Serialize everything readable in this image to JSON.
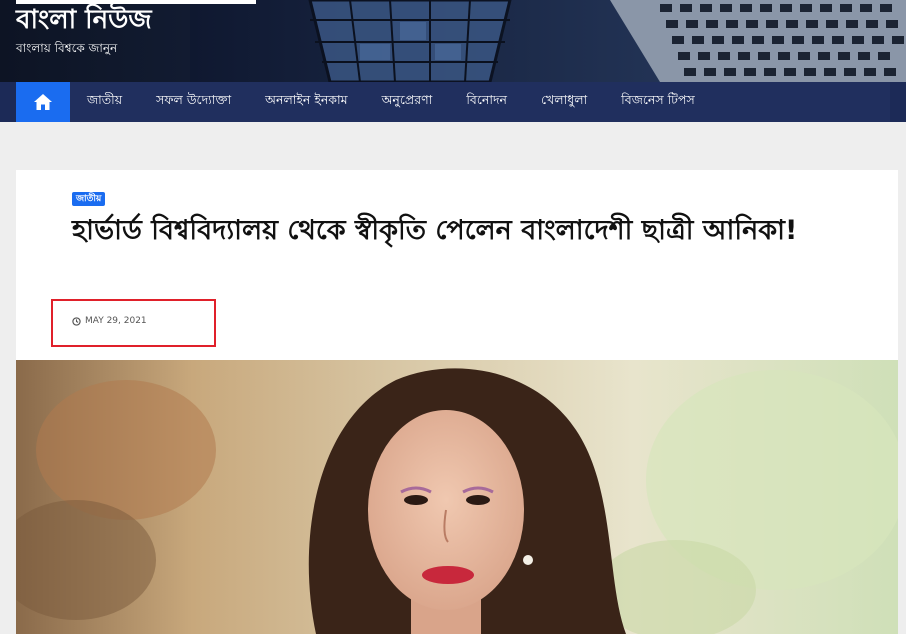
{
  "site": {
    "title": "বাংলা নিউজ",
    "tagline": "বাংলায় বিশ্বকে জানুন"
  },
  "nav": {
    "home_icon": "home-icon",
    "items": [
      {
        "label": "জাতীয়"
      },
      {
        "label": "সফল উদ্যোক্তা"
      },
      {
        "label": "অনলাইন ইনকাম"
      },
      {
        "label": "অনুপ্রেরণা"
      },
      {
        "label": "বিনোদন"
      },
      {
        "label": "খেলাধুলা"
      },
      {
        "label": "বিজনেস টিপস"
      }
    ]
  },
  "article": {
    "category": "জাতীয়",
    "headline": "হার্ভার্ড বিশ্ববিদ্যালয় থেকে স্বীকৃতি পেলেন বাংলাদেশী ছাত্রী আনিকা!",
    "date": "MAY 29, 2021",
    "date_icon": "clock-icon"
  },
  "colors": {
    "accent": "#1a6cf0",
    "nav_bg": "#202f5e",
    "highlight": "#e0202a"
  }
}
